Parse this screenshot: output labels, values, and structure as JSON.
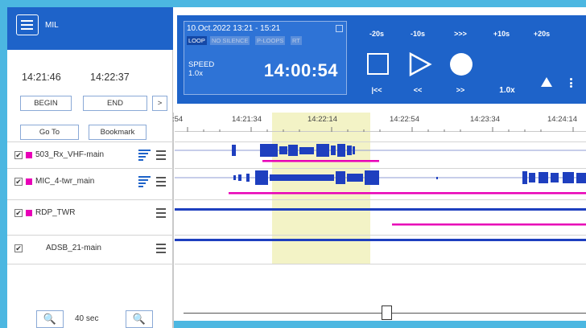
{
  "menu": {
    "label": "MIL"
  },
  "range": {
    "start_time": "14:21:46",
    "end_time": "14:22:37"
  },
  "buttons": {
    "begin": "BEGIN",
    "end": "END",
    "next": ">",
    "goto": "Go To",
    "bookmark": "Bookmark"
  },
  "channels": [
    {
      "name": "503_Rx_VHF-main",
      "checked": "✔",
      "has_marker": true,
      "has_filter": true
    },
    {
      "name": "MIC_4-twr_main",
      "checked": "✔",
      "has_marker": true,
      "has_filter": true
    },
    {
      "name": "RDP_TWR",
      "checked": "✔",
      "has_marker": true,
      "has_filter": false
    },
    {
      "name": "ADSB_21-main",
      "checked": "✔",
      "has_marker": false,
      "has_filter": false
    }
  ],
  "zoom": {
    "in_icon": "zoom-in-icon",
    "out_icon": "zoom-out-icon",
    "in_glyph": "🔍",
    "out_glyph": "🔍",
    "level": "40 sec"
  },
  "player": {
    "date_range": "10.Oct.2022  13:21 - 15:21",
    "tags": [
      "LOOP",
      "NO SILENCE",
      "P-LOOPS",
      "RT"
    ],
    "speed_label": "SPEED",
    "speed_value": "1.0x",
    "current_time": "14:00:54",
    "jumps": [
      "-20s",
      "-10s",
      ">>>",
      "+10s",
      "+20s"
    ],
    "nav": [
      "|<<",
      "<<",
      ">>",
      "1.0x"
    ],
    "colors": {
      "panel": "#1e63c9",
      "accent_magenta": "#e800b7",
      "frame": "#4cb7e1"
    }
  },
  "timeline": {
    "ticks": [
      ":54",
      "14:21:34",
      "14:22:14",
      "14:22:54",
      "14:23:34",
      "14:24:14"
    ]
  }
}
